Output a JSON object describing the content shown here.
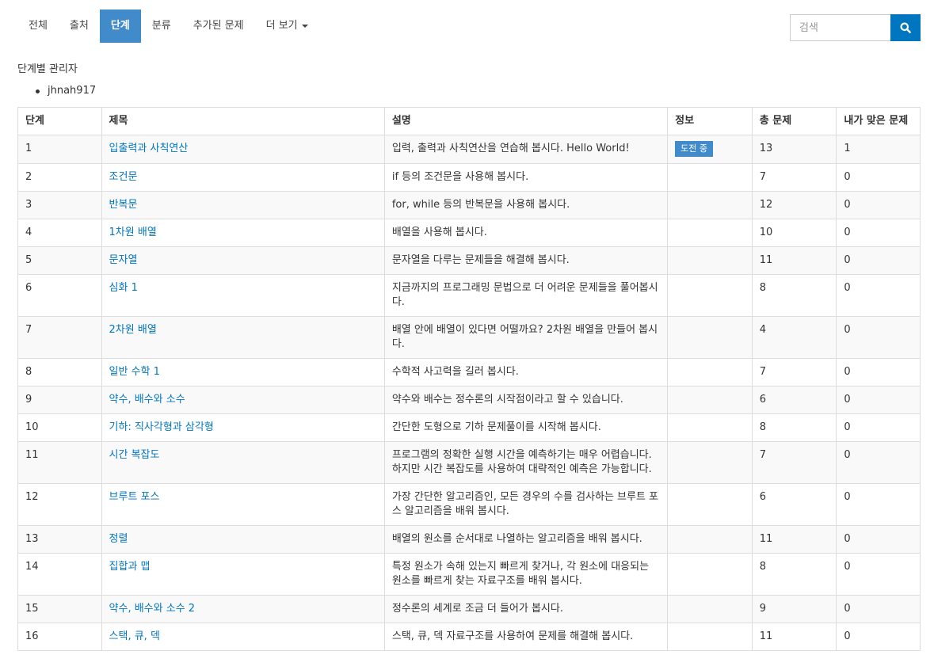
{
  "nav": {
    "tabs": [
      {
        "label": "전체"
      },
      {
        "label": "출처"
      },
      {
        "label": "단계"
      },
      {
        "label": "분류"
      },
      {
        "label": "추가된 문제"
      },
      {
        "label": "더 보기"
      }
    ],
    "active_tab": "단계"
  },
  "search": {
    "placeholder": "검색",
    "icon": "search-icon"
  },
  "managers": {
    "heading": "단계별 관리자",
    "list": [
      "jhnah917"
    ]
  },
  "table": {
    "columns": [
      "단계",
      "제목",
      "설명",
      "정보",
      "총 문제",
      "내가 맞은 문제"
    ],
    "rows": [
      {
        "step": "1",
        "title": "입출력과 사칙연산",
        "description": "입력, 출력과 사칙연산을 연습해 봅시다. Hello World!",
        "info": "도전 중",
        "total": "13",
        "solved": "1"
      },
      {
        "step": "2",
        "title": "조건문",
        "description": "if 등의 조건문을 사용해 봅시다.",
        "info": "",
        "total": "7",
        "solved": "0"
      },
      {
        "step": "3",
        "title": "반복문",
        "description": "for, while 등의 반복문을 사용해 봅시다.",
        "info": "",
        "total": "12",
        "solved": "0"
      },
      {
        "step": "4",
        "title": "1차원 배열",
        "description": "배열을 사용해 봅시다.",
        "info": "",
        "total": "10",
        "solved": "0"
      },
      {
        "step": "5",
        "title": "문자열",
        "description": "문자열을 다루는 문제들을 해결해 봅시다.",
        "info": "",
        "total": "11",
        "solved": "0"
      },
      {
        "step": "6",
        "title": "심화 1",
        "description": "지금까지의 프로그래밍 문법으로 더 어려운 문제들을 풀어봅시다.",
        "info": "",
        "total": "8",
        "solved": "0"
      },
      {
        "step": "7",
        "title": "2차원 배열",
        "description": "배열 안에 배열이 있다면 어떨까요? 2차원 배열을 만들어 봅시다.",
        "info": "",
        "total": "4",
        "solved": "0"
      },
      {
        "step": "8",
        "title": "일반 수학 1",
        "description": "수학적 사고력을 길러 봅시다.",
        "info": "",
        "total": "7",
        "solved": "0"
      },
      {
        "step": "9",
        "title": "약수, 배수와 소수",
        "description": "약수와 배수는 정수론의 시작점이라고 할 수 있습니다.",
        "info": "",
        "total": "6",
        "solved": "0"
      },
      {
        "step": "10",
        "title": "기하: 직사각형과 삼각형",
        "description": "간단한 도형으로 기하 문제풀이를 시작해 봅시다.",
        "info": "",
        "total": "8",
        "solved": "0"
      },
      {
        "step": "11",
        "title": "시간 복잡도",
        "description": "프로그램의 정확한 실행 시간을 예측하기는 매우 어렵습니다. 하지만 시간 복잡도를 사용하여 대략적인 예측은 가능합니다.",
        "info": "",
        "total": "7",
        "solved": "0"
      },
      {
        "step": "12",
        "title": "브루트 포스",
        "description": "가장 간단한 알고리즘인, 모든 경우의 수를 검사하는 브루트 포스 알고리즘을 배워 봅시다.",
        "info": "",
        "total": "6",
        "solved": "0"
      },
      {
        "step": "13",
        "title": "정렬",
        "description": "배열의 원소를 순서대로 나열하는 알고리즘을 배워 봅시다.",
        "info": "",
        "total": "11",
        "solved": "0"
      },
      {
        "step": "14",
        "title": "집합과 맵",
        "description": "특정 원소가 속해 있는지 빠르게 찾거나, 각 원소에 대응되는 원소를 빠르게 찾는 자료구조를 배워 봅시다.",
        "info": "",
        "total": "8",
        "solved": "0"
      },
      {
        "step": "15",
        "title": "약수, 배수와 소수 2",
        "description": "정수론의 세계로 조금 더 들어가 봅시다.",
        "info": "",
        "total": "9",
        "solved": "0"
      },
      {
        "step": "16",
        "title": "스택, 큐, 덱",
        "description": "스택, 큐, 덱 자료구조를 사용하여 문제를 해결해 봅시다.",
        "info": "",
        "total": "11",
        "solved": "0"
      }
    ]
  },
  "colors": {
    "accent": "#428bca",
    "link": "#0076c0",
    "search_button": "#0076c0"
  }
}
